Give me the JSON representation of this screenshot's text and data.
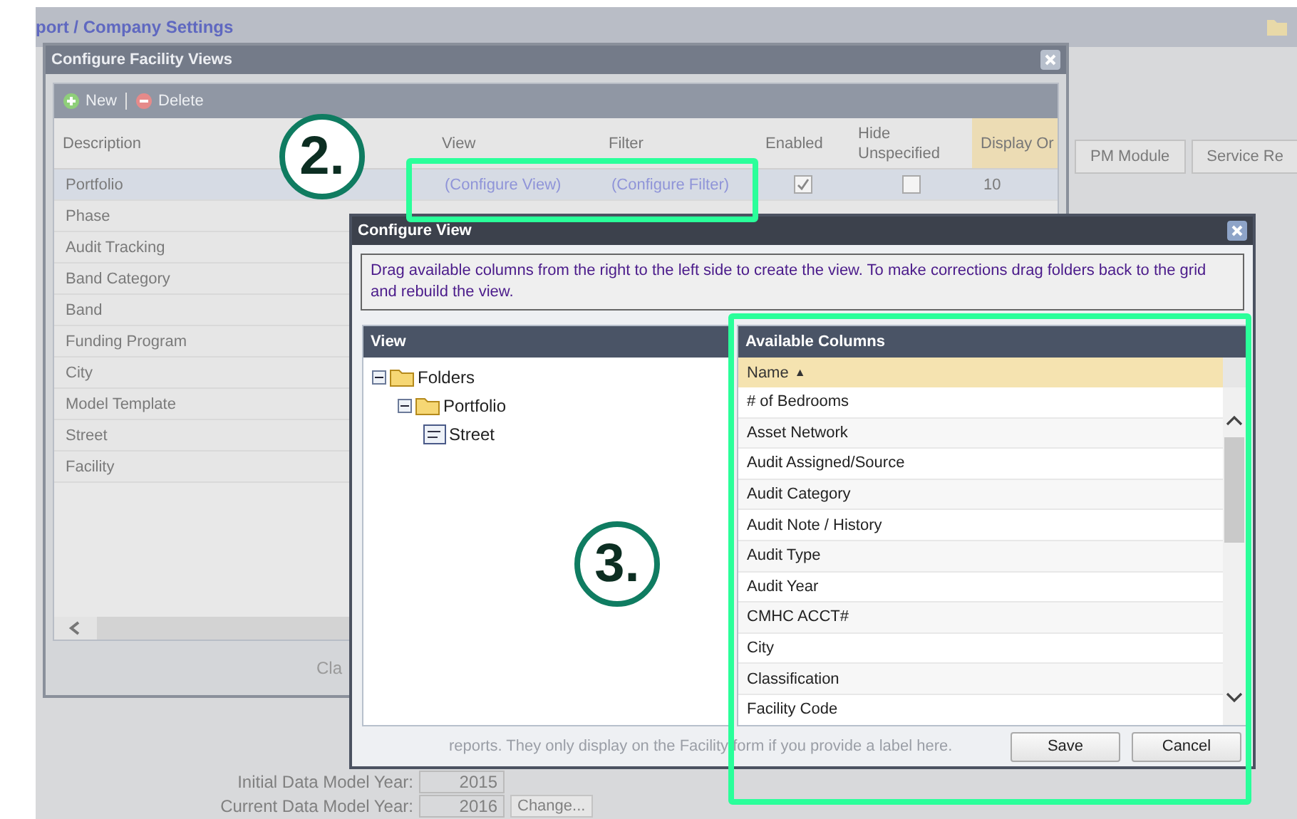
{
  "breadcrumb": "port / Company Settings",
  "background_tabs": [
    "PM Module",
    "Service Re"
  ],
  "background_form": {
    "cut_label": "Cla",
    "note": "reports. They only display on the Facility form if you provide a label here.",
    "fields": [
      {
        "label": "Initial Data Model Year:",
        "value": "2015"
      },
      {
        "label": "Current Data Model Year:",
        "value": "2016",
        "button": "Change..."
      }
    ]
  },
  "facility_views": {
    "title": "Configure Facility Views",
    "toolbar": [
      {
        "kind": "add",
        "label": "New"
      },
      {
        "kind": "delete",
        "label": "Delete"
      }
    ],
    "columns": [
      "Description",
      "View",
      "Filter",
      "Enabled",
      "Hide Unspecified",
      "Display Or"
    ],
    "rows": [
      {
        "description": "Portfolio",
        "view": "(Configure View)",
        "filter": "(Configure Filter)",
        "enabled": true,
        "hide_unspecified": false,
        "display_order": "10",
        "selected": true
      },
      {
        "description": "Phase",
        "selected": false
      },
      {
        "description": "Audit Tracking",
        "selected": false
      },
      {
        "description": "Band Category",
        "selected": false
      },
      {
        "description": "Band",
        "selected": false
      },
      {
        "description": "Funding Program",
        "selected": false
      },
      {
        "description": "City",
        "selected": false
      },
      {
        "description": "Model Template",
        "selected": false
      },
      {
        "description": "Street",
        "selected": false
      },
      {
        "description": "Facility",
        "selected": false
      }
    ]
  },
  "configure_view": {
    "title": "Configure View",
    "instructions": "Drag available columns from the right to the left side to create the view. To make corrections drag folders back to the grid and rebuild the view.",
    "view_panel": {
      "title": "View",
      "tree": [
        {
          "label": "Folders",
          "kind": "folder",
          "expanded": true,
          "children": [
            {
              "label": "Portfolio",
              "kind": "folder",
              "expanded": true,
              "children": [
                {
                  "label": "Street",
                  "kind": "field"
                }
              ]
            }
          ]
        }
      ]
    },
    "available": {
      "title": "Available Columns",
      "sort_column": "Name",
      "sort_indicator": "▲",
      "items": [
        "# of Bedrooms",
        "Asset Network",
        "Audit Assigned/Source",
        "Audit Category",
        "Audit Note / History",
        "Audit Type",
        "Audit Year",
        "CMHC ACCT#",
        "City",
        "Classification",
        "Facility Code"
      ]
    },
    "buttons": [
      "Save",
      "Cancel"
    ]
  },
  "annotations": [
    {
      "label": "2."
    },
    {
      "label": "3."
    }
  ]
}
